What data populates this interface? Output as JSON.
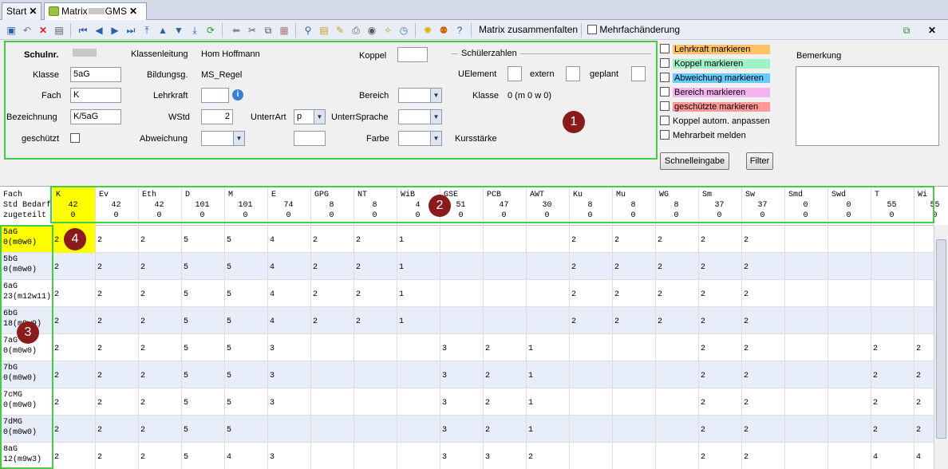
{
  "tabs": [
    {
      "label": "Start"
    },
    {
      "label": "Matrix",
      "label_suffix": "GMS"
    }
  ],
  "toolbar": {
    "collapse_label": "Matrix zusammenfalten",
    "multi_change_label": "Mehrfachänderung"
  },
  "form": {
    "schulnr_label": "Schulnr.",
    "klassenleitung_label": "Klassenleitung",
    "klassenleitung_value": "Hom Hoffmann",
    "klasse_label": "Klasse",
    "klasse_value": "5aG",
    "bildungsg_label": "Bildungsg.",
    "bildungsg_value": "MS_Regel",
    "fach_label": "Fach",
    "fach_value": "K",
    "lehrkraft_label": "Lehrkraft",
    "bezeichnung_label": "Bezeichnung",
    "bezeichnung_value": "K/5aG",
    "wstd_label": "WStd",
    "wstd_value": "2",
    "unterrart_label": "UnterrArt",
    "unterrart_value": "p",
    "unterrsprache_label": "UnterrSprache",
    "geschuetzt_label": "geschützt",
    "abweichung_label": "Abweichung",
    "koppel_label": "Koppel",
    "bereich_label": "Bereich",
    "farbe_label": "Farbe",
    "schuelerzahlen_label": "Schülerzahlen",
    "uelement_label": "UElement",
    "extern_label": "extern",
    "geplant_label": "geplant",
    "klasse_sz_label": "Klasse",
    "klasse_sz_value": "0 (m 0 w 0)",
    "kursstaerke_label": "Kursstärke"
  },
  "markers": [
    {
      "label": "Lehrkraft markieren",
      "color": "#ffc266"
    },
    {
      "label": "Koppel markieren",
      "color": "#9ef2c7"
    },
    {
      "label": "Abweichung markieren",
      "color": "#66ccff"
    },
    {
      "label": "Bereich markieren",
      "color": "#f5b3f0"
    },
    {
      "label": "geschützte markieren",
      "color": "#ff9999"
    },
    {
      "label": "Koppel autom. anpassen",
      "color": ""
    },
    {
      "label": "Mehrarbeit melden",
      "color": ""
    }
  ],
  "bemerkung_label": "Bemerkung",
  "buttons": {
    "schnelleingabe": "Schnelleingabe",
    "filter": "Filter"
  },
  "badges": [
    "1",
    "2",
    "3",
    "4"
  ],
  "matrix": {
    "row_headers": [
      "Fach",
      "Std Bedarf",
      "zugeteilt"
    ],
    "subjects": [
      {
        "name": "K",
        "bedarf": "42",
        "zugeteilt": "0"
      },
      {
        "name": "Ev",
        "bedarf": "42",
        "zugeteilt": "0"
      },
      {
        "name": "Eth",
        "bedarf": "42",
        "zugeteilt": "0"
      },
      {
        "name": "D",
        "bedarf": "101",
        "zugeteilt": "0"
      },
      {
        "name": "M",
        "bedarf": "101",
        "zugeteilt": "0"
      },
      {
        "name": "E",
        "bedarf": "74",
        "zugeteilt": "0"
      },
      {
        "name": "GPG",
        "bedarf": "8",
        "zugeteilt": "0"
      },
      {
        "name": "NT",
        "bedarf": "8",
        "zugeteilt": "0"
      },
      {
        "name": "WiB",
        "bedarf": "4",
        "zugeteilt": "0"
      },
      {
        "name": "GSE",
        "bedarf": "51",
        "zugeteilt": "0"
      },
      {
        "name": "PCB",
        "bedarf": "47",
        "zugeteilt": "0"
      },
      {
        "name": "AWT",
        "bedarf": "30",
        "zugeteilt": "0"
      },
      {
        "name": "Ku",
        "bedarf": "8",
        "zugeteilt": "0"
      },
      {
        "name": "Mu",
        "bedarf": "8",
        "zugeteilt": "0"
      },
      {
        "name": "WG",
        "bedarf": "8",
        "zugeteilt": "0"
      },
      {
        "name": "Sm",
        "bedarf": "37",
        "zugeteilt": "0"
      },
      {
        "name": "Sw",
        "bedarf": "37",
        "zugeteilt": "0"
      },
      {
        "name": "Smd",
        "bedarf": "0",
        "zugeteilt": "0"
      },
      {
        "name": "Swd",
        "bedarf": "0",
        "zugeteilt": "0"
      },
      {
        "name": "T",
        "bedarf": "55",
        "zugeteilt": "0"
      },
      {
        "name": "Wi",
        "bedarf": "55",
        "zugeteilt": "0"
      }
    ],
    "rows": [
      {
        "klasse": "5aG",
        "info": "0(m0w0)",
        "values": [
          "2",
          "2",
          "2",
          "5",
          "5",
          "4",
          "2",
          "2",
          "1",
          "",
          "",
          "",
          "2",
          "2",
          "2",
          "2",
          "2",
          "",
          "",
          "",
          ""
        ]
      },
      {
        "klasse": "5bG",
        "info": "0(m0w0)",
        "values": [
          "2",
          "2",
          "2",
          "5",
          "5",
          "4",
          "2",
          "2",
          "1",
          "",
          "",
          "",
          "2",
          "2",
          "2",
          "2",
          "2",
          "",
          "",
          "",
          ""
        ]
      },
      {
        "klasse": "6aG",
        "info": "23(m12w11)",
        "values": [
          "2",
          "2",
          "2",
          "5",
          "5",
          "4",
          "2",
          "2",
          "1",
          "",
          "",
          "",
          "2",
          "2",
          "2",
          "2",
          "2",
          "",
          "",
          "",
          ""
        ]
      },
      {
        "klasse": "6bG",
        "info": "18(m9w9)",
        "values": [
          "2",
          "2",
          "2",
          "5",
          "5",
          "4",
          "2",
          "2",
          "1",
          "",
          "",
          "",
          "2",
          "2",
          "2",
          "2",
          "2",
          "",
          "",
          "",
          ""
        ]
      },
      {
        "klasse": "7aG",
        "info": "0(m0w0)",
        "values": [
          "2",
          "2",
          "2",
          "5",
          "5",
          "3",
          "",
          "",
          "",
          "3",
          "2",
          "1",
          "",
          "",
          "",
          "2",
          "2",
          "",
          "",
          "2",
          "2"
        ]
      },
      {
        "klasse": "7bG",
        "info": "0(m0w0)",
        "values": [
          "2",
          "2",
          "2",
          "5",
          "5",
          "3",
          "",
          "",
          "",
          "3",
          "2",
          "1",
          "",
          "",
          "",
          "2",
          "2",
          "",
          "",
          "2",
          "2"
        ]
      },
      {
        "klasse": "7cMG",
        "info": "0(m0w0)",
        "values": [
          "2",
          "2",
          "2",
          "5",
          "5",
          "3",
          "",
          "",
          "",
          "3",
          "2",
          "1",
          "",
          "",
          "",
          "2",
          "2",
          "",
          "",
          "2",
          "2"
        ]
      },
      {
        "klasse": "7dMG",
        "info": "0(m0w0)",
        "values": [
          "2",
          "2",
          "2",
          "5",
          "5",
          "",
          "",
          "",
          "",
          "3",
          "2",
          "1",
          "",
          "",
          "",
          "2",
          "2",
          "",
          "",
          "2",
          "2"
        ]
      },
      {
        "klasse": "8aG",
        "info": "12(m9w3)",
        "values": [
          "2",
          "2",
          "2",
          "5",
          "4",
          "3",
          "",
          "",
          "",
          "3",
          "3",
          "2",
          "",
          "",
          "",
          "2",
          "2",
          "",
          "",
          "4",
          "4"
        ]
      }
    ]
  }
}
